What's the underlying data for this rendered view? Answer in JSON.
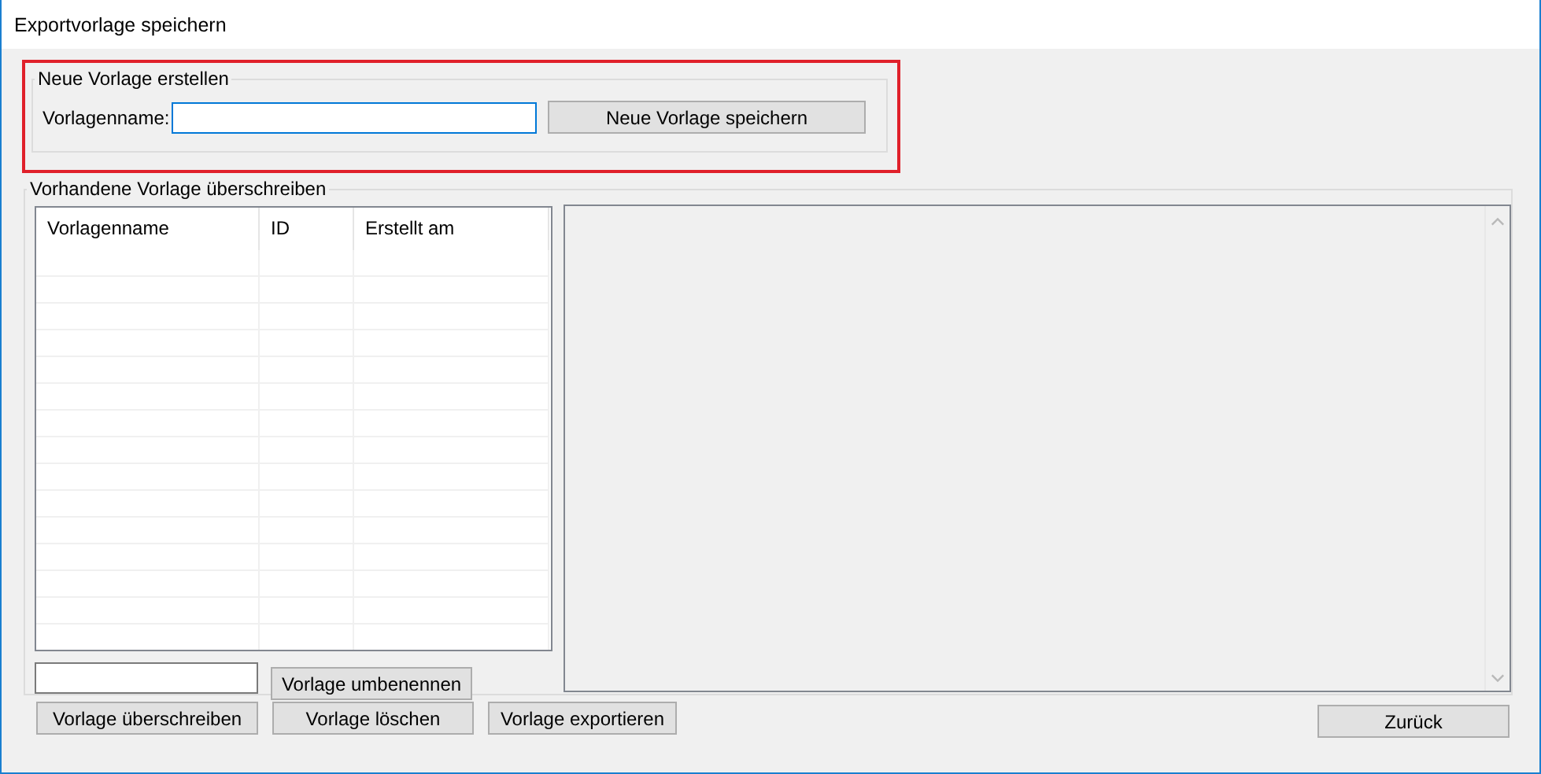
{
  "window": {
    "title": "Exportvorlage speichern"
  },
  "new_template": {
    "title": "Neue Vorlage erstellen",
    "highlighted": true,
    "name_label": "Vorlagenname:",
    "save_button": "Neue Vorlage speichern"
  },
  "existing_templates": {
    "title": "Vorhandene Vorlage überschreiben",
    "table": {
      "columns": [
        "Vorlagenname",
        "ID",
        "Erstellt am"
      ]
    },
    "rename_button": "Vorlage umbenennen"
  },
  "buttons": [
    "Vorlage überschreiben",
    "Vorlage löschen",
    "Vorlage exportieren"
  ],
  "back_button": "Zurück"
}
